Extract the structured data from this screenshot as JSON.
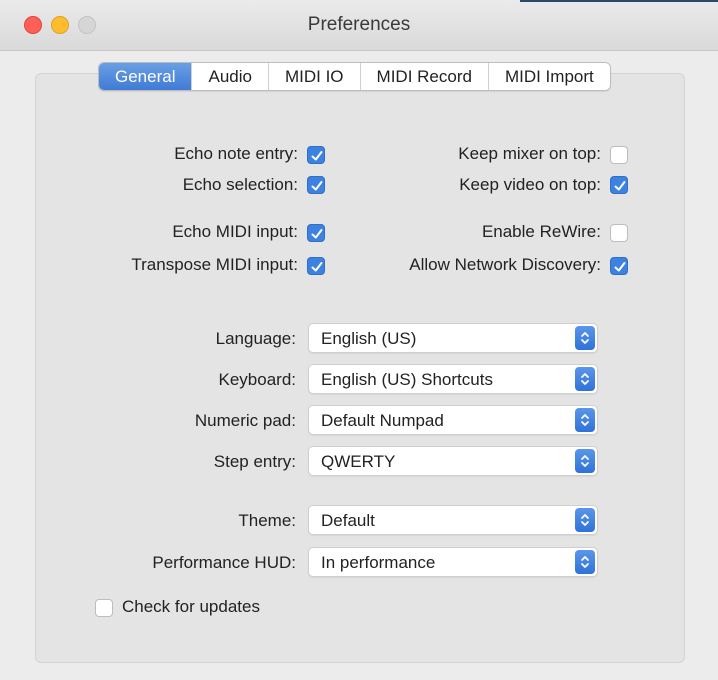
{
  "window": {
    "title": "Preferences"
  },
  "tabs": [
    {
      "label": "General",
      "active": true
    },
    {
      "label": "Audio",
      "active": false
    },
    {
      "label": "MIDI IO",
      "active": false
    },
    {
      "label": "MIDI Record",
      "active": false
    },
    {
      "label": "MIDI Import",
      "active": false
    }
  ],
  "options": {
    "echo_note_entry": {
      "label": "Echo note entry:",
      "checked": true
    },
    "echo_selection": {
      "label": "Echo selection:",
      "checked": true
    },
    "echo_midi_input": {
      "label": "Echo MIDI input:",
      "checked": true
    },
    "transpose_midi_input": {
      "label": "Transpose MIDI input:",
      "checked": true
    },
    "keep_mixer_on_top": {
      "label": "Keep mixer on top:",
      "checked": false
    },
    "keep_video_on_top": {
      "label": "Keep video on top:",
      "checked": true
    },
    "enable_rewire": {
      "label": "Enable ReWire:",
      "checked": false
    },
    "allow_network_discovery": {
      "label": "Allow Network Discovery:",
      "checked": true
    }
  },
  "selects": {
    "language": {
      "label": "Language:",
      "value": "English (US)"
    },
    "keyboard": {
      "label": "Keyboard:",
      "value": "English (US) Shortcuts"
    },
    "numeric_pad": {
      "label": "Numeric pad:",
      "value": "Default Numpad"
    },
    "step_entry": {
      "label": "Step entry:",
      "value": "QWERTY"
    },
    "theme": {
      "label": "Theme:",
      "value": "Default"
    },
    "performance_hud": {
      "label": "Performance HUD:",
      "value": "In performance"
    }
  },
  "check_updates": {
    "label": "Check for updates",
    "checked": false
  },
  "colors": {
    "accent": "#3d82e0",
    "close": "#fe5f57",
    "minimize": "#febc2e"
  }
}
